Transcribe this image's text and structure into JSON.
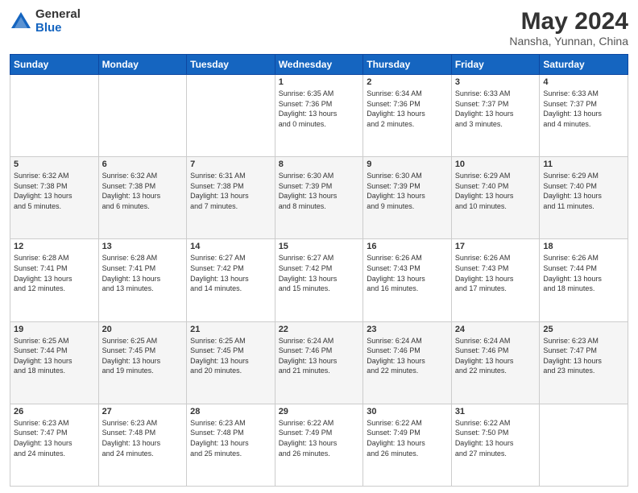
{
  "logo": {
    "general": "General",
    "blue": "Blue"
  },
  "header": {
    "title": "May 2024",
    "subtitle": "Nansha, Yunnan, China"
  },
  "weekdays": [
    "Sunday",
    "Monday",
    "Tuesday",
    "Wednesday",
    "Thursday",
    "Friday",
    "Saturday"
  ],
  "weeks": [
    [
      {
        "day": "",
        "info": ""
      },
      {
        "day": "",
        "info": ""
      },
      {
        "day": "",
        "info": ""
      },
      {
        "day": "1",
        "info": "Sunrise: 6:35 AM\nSunset: 7:36 PM\nDaylight: 13 hours\nand 0 minutes."
      },
      {
        "day": "2",
        "info": "Sunrise: 6:34 AM\nSunset: 7:36 PM\nDaylight: 13 hours\nand 2 minutes."
      },
      {
        "day": "3",
        "info": "Sunrise: 6:33 AM\nSunset: 7:37 PM\nDaylight: 13 hours\nand 3 minutes."
      },
      {
        "day": "4",
        "info": "Sunrise: 6:33 AM\nSunset: 7:37 PM\nDaylight: 13 hours\nand 4 minutes."
      }
    ],
    [
      {
        "day": "5",
        "info": "Sunrise: 6:32 AM\nSunset: 7:38 PM\nDaylight: 13 hours\nand 5 minutes."
      },
      {
        "day": "6",
        "info": "Sunrise: 6:32 AM\nSunset: 7:38 PM\nDaylight: 13 hours\nand 6 minutes."
      },
      {
        "day": "7",
        "info": "Sunrise: 6:31 AM\nSunset: 7:38 PM\nDaylight: 13 hours\nand 7 minutes."
      },
      {
        "day": "8",
        "info": "Sunrise: 6:30 AM\nSunset: 7:39 PM\nDaylight: 13 hours\nand 8 minutes."
      },
      {
        "day": "9",
        "info": "Sunrise: 6:30 AM\nSunset: 7:39 PM\nDaylight: 13 hours\nand 9 minutes."
      },
      {
        "day": "10",
        "info": "Sunrise: 6:29 AM\nSunset: 7:40 PM\nDaylight: 13 hours\nand 10 minutes."
      },
      {
        "day": "11",
        "info": "Sunrise: 6:29 AM\nSunset: 7:40 PM\nDaylight: 13 hours\nand 11 minutes."
      }
    ],
    [
      {
        "day": "12",
        "info": "Sunrise: 6:28 AM\nSunset: 7:41 PM\nDaylight: 13 hours\nand 12 minutes."
      },
      {
        "day": "13",
        "info": "Sunrise: 6:28 AM\nSunset: 7:41 PM\nDaylight: 13 hours\nand 13 minutes."
      },
      {
        "day": "14",
        "info": "Sunrise: 6:27 AM\nSunset: 7:42 PM\nDaylight: 13 hours\nand 14 minutes."
      },
      {
        "day": "15",
        "info": "Sunrise: 6:27 AM\nSunset: 7:42 PM\nDaylight: 13 hours\nand 15 minutes."
      },
      {
        "day": "16",
        "info": "Sunrise: 6:26 AM\nSunset: 7:43 PM\nDaylight: 13 hours\nand 16 minutes."
      },
      {
        "day": "17",
        "info": "Sunrise: 6:26 AM\nSunset: 7:43 PM\nDaylight: 13 hours\nand 17 minutes."
      },
      {
        "day": "18",
        "info": "Sunrise: 6:26 AM\nSunset: 7:44 PM\nDaylight: 13 hours\nand 18 minutes."
      }
    ],
    [
      {
        "day": "19",
        "info": "Sunrise: 6:25 AM\nSunset: 7:44 PM\nDaylight: 13 hours\nand 18 minutes."
      },
      {
        "day": "20",
        "info": "Sunrise: 6:25 AM\nSunset: 7:45 PM\nDaylight: 13 hours\nand 19 minutes."
      },
      {
        "day": "21",
        "info": "Sunrise: 6:25 AM\nSunset: 7:45 PM\nDaylight: 13 hours\nand 20 minutes."
      },
      {
        "day": "22",
        "info": "Sunrise: 6:24 AM\nSunset: 7:46 PM\nDaylight: 13 hours\nand 21 minutes."
      },
      {
        "day": "23",
        "info": "Sunrise: 6:24 AM\nSunset: 7:46 PM\nDaylight: 13 hours\nand 22 minutes."
      },
      {
        "day": "24",
        "info": "Sunrise: 6:24 AM\nSunset: 7:46 PM\nDaylight: 13 hours\nand 22 minutes."
      },
      {
        "day": "25",
        "info": "Sunrise: 6:23 AM\nSunset: 7:47 PM\nDaylight: 13 hours\nand 23 minutes."
      }
    ],
    [
      {
        "day": "26",
        "info": "Sunrise: 6:23 AM\nSunset: 7:47 PM\nDaylight: 13 hours\nand 24 minutes."
      },
      {
        "day": "27",
        "info": "Sunrise: 6:23 AM\nSunset: 7:48 PM\nDaylight: 13 hours\nand 24 minutes."
      },
      {
        "day": "28",
        "info": "Sunrise: 6:23 AM\nSunset: 7:48 PM\nDaylight: 13 hours\nand 25 minutes."
      },
      {
        "day": "29",
        "info": "Sunrise: 6:22 AM\nSunset: 7:49 PM\nDaylight: 13 hours\nand 26 minutes."
      },
      {
        "day": "30",
        "info": "Sunrise: 6:22 AM\nSunset: 7:49 PM\nDaylight: 13 hours\nand 26 minutes."
      },
      {
        "day": "31",
        "info": "Sunrise: 6:22 AM\nSunset: 7:50 PM\nDaylight: 13 hours\nand 27 minutes."
      },
      {
        "day": "",
        "info": ""
      }
    ]
  ]
}
